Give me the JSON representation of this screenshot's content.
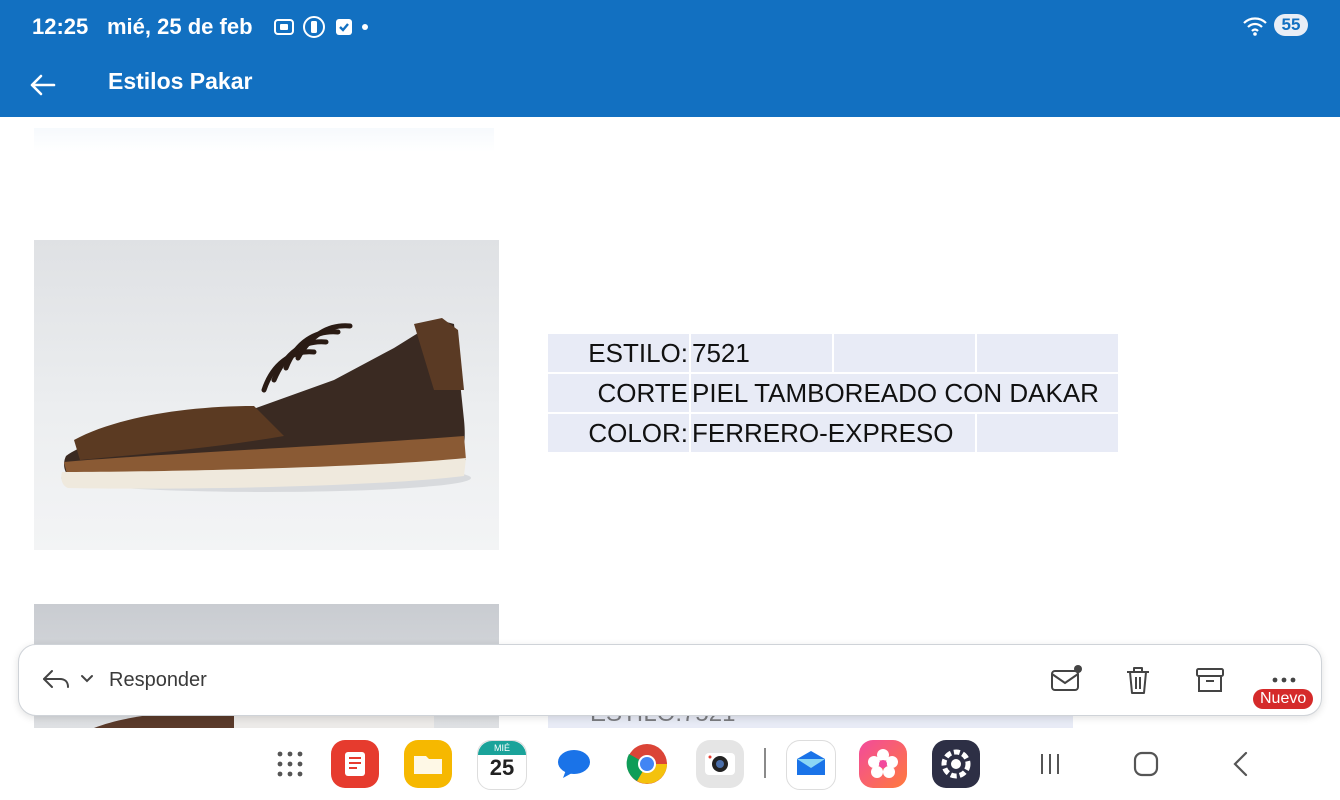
{
  "status": {
    "time": "12:25",
    "date": "mié, 25 de feb",
    "battery": "55",
    "icons": [
      "screenshot-icon",
      "vibrate-icon",
      "checkbox-icon",
      "wifi-icon"
    ]
  },
  "appbar": {
    "title": "Estilos Pakar"
  },
  "spec": {
    "rows": [
      {
        "label": "ESTILO:",
        "value": "7521"
      },
      {
        "label": "CORTE",
        "value": "PIEL TAMBOREADO  CON DAKAR"
      },
      {
        "label": "COLOR:",
        "value": "FERRERO-EXPRESO"
      }
    ]
  },
  "partial_second": {
    "text": "ESTILO:7521"
  },
  "replybar": {
    "reply_label": "Responder",
    "badge": "Nuevo"
  },
  "dock": {
    "calendar_day_label": "MIÉ",
    "calendar_day_num": "25"
  },
  "colors": {
    "appbar": "#1270c1",
    "badge": "#d52a2a",
    "table_bg": "#e8ebf6"
  }
}
